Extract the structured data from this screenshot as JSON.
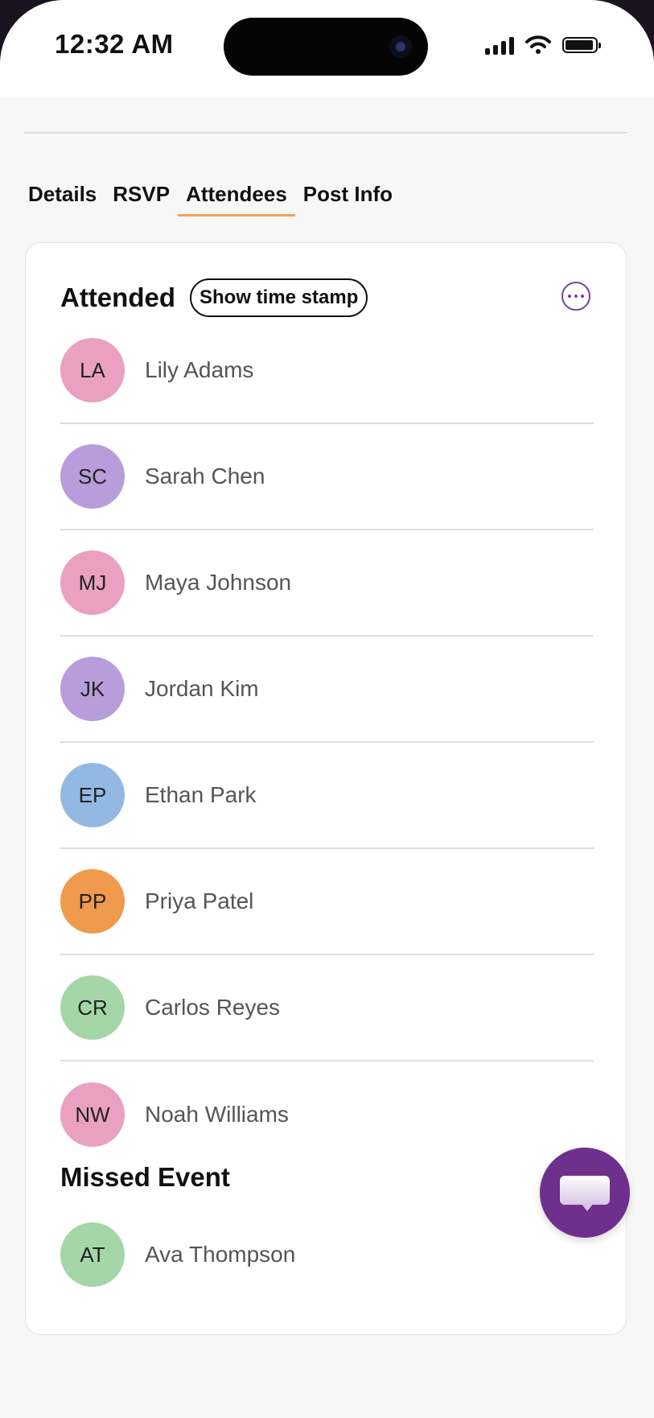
{
  "status_bar": {
    "time": "12:32 AM"
  },
  "tabs": [
    {
      "label": "Details",
      "active": false
    },
    {
      "label": "RSVP",
      "active": false
    },
    {
      "label": "Attendees",
      "active": true
    },
    {
      "label": "Post Info",
      "active": false
    }
  ],
  "attended": {
    "title": "Attended",
    "timestamp_button": "Show time stamp",
    "people": [
      {
        "initials": "LA",
        "name": "Lily Adams",
        "color": "#e9a0c1"
      },
      {
        "initials": "SC",
        "name": "Sarah Chen",
        "color": "#b89ddb"
      },
      {
        "initials": "MJ",
        "name": "Maya Johnson",
        "color": "#e9a0c1"
      },
      {
        "initials": "JK",
        "name": "Jordan Kim",
        "color": "#b89ddb"
      },
      {
        "initials": "EP",
        "name": "Ethan Park",
        "color": "#93b9e2"
      },
      {
        "initials": "PP",
        "name": "Priya Patel",
        "color": "#ef9a4d"
      },
      {
        "initials": "CR",
        "name": "Carlos Reyes",
        "color": "#a5d6a7"
      },
      {
        "initials": "NW",
        "name": "Noah Williams",
        "color": "#e9a0c1"
      }
    ]
  },
  "missed": {
    "title": "Missed Event",
    "people": [
      {
        "initials": "AT",
        "name": "Ava Thompson",
        "color": "#a5d6a7"
      }
    ]
  },
  "colors": {
    "accent_purple": "#6f2f8d",
    "tab_underline": "#f0a25a"
  }
}
